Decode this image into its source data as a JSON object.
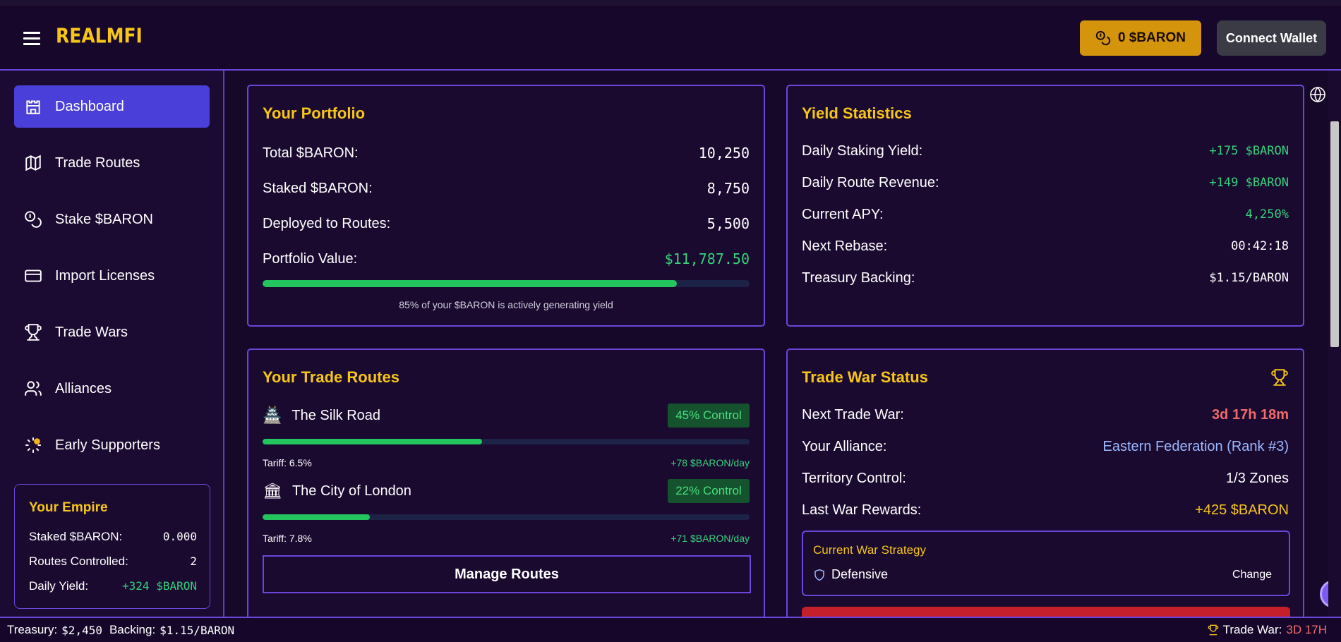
{
  "header": {
    "logo": "REALMFI",
    "baron_balance": "0 $BARON",
    "connect_wallet": "Connect Wallet"
  },
  "sidebar": {
    "items": [
      {
        "label": "Dashboard",
        "icon": "castle-icon",
        "active": true
      },
      {
        "label": "Trade Routes",
        "icon": "map-icon"
      },
      {
        "label": "Stake $BARON",
        "icon": "coins-icon"
      },
      {
        "label": "Import Licenses",
        "icon": "credit-card-icon"
      },
      {
        "label": "Trade Wars",
        "icon": "trophy-icon"
      },
      {
        "label": "Alliances",
        "icon": "users-icon"
      },
      {
        "label": "Early Supporters",
        "icon": "sparkle-icon"
      }
    ],
    "empire": {
      "title": "Your Empire",
      "rows": [
        {
          "label": "Staked $BARON:",
          "value": "0.000"
        },
        {
          "label": "Routes Controlled:",
          "value": "2"
        },
        {
          "label": "Daily Yield:",
          "value": "+324 $BARON"
        }
      ]
    }
  },
  "portfolio": {
    "title": "Your Portfolio",
    "rows": [
      {
        "label": "Total $BARON:",
        "value": "10,250"
      },
      {
        "label": "Staked $BARON:",
        "value": "8,750"
      },
      {
        "label": "Deployed to Routes:",
        "value": "5,500"
      },
      {
        "label": "Portfolio Value:",
        "value": "$11,787.50"
      }
    ],
    "progress": 0.85,
    "caption": "85% of your $BARON is actively generating yield"
  },
  "yield": {
    "title": "Yield Statistics",
    "rows": [
      {
        "label": "Daily Staking Yield:",
        "value": "+175 $BARON"
      },
      {
        "label": "Daily Route Revenue:",
        "value": "+149 $BARON"
      },
      {
        "label": "Current APY:",
        "value": "4,250%"
      },
      {
        "label": "Next Rebase:",
        "value": "00:42:18"
      },
      {
        "label": "Treasury Backing:",
        "value": "$1.15/BARON"
      }
    ]
  },
  "routes": {
    "title": "Your Trade Routes",
    "items": [
      {
        "name": "The Silk Road",
        "emoji": "🏯",
        "control": "45% Control",
        "progress": 0.45,
        "tariff": "Tariff: 6.5%",
        "yield": "+78 $BARON/day"
      },
      {
        "name": "The City of London",
        "emoji": "🏛",
        "control": "22% Control",
        "progress": 0.22,
        "tariff": "Tariff: 7.8%",
        "yield": "+71 $BARON/day"
      }
    ],
    "manage": "Manage Routes"
  },
  "war": {
    "title": "Trade War Status",
    "rows": [
      {
        "label": "Next Trade War:",
        "value": "3d 17h 18m"
      },
      {
        "label": "Your Alliance:",
        "value": "Eastern Federation (Rank #3)"
      },
      {
        "label": "Territory Control:",
        "value": "1/3 Zones"
      },
      {
        "label": "Last War Rewards:",
        "value": "+425 $BARON"
      }
    ],
    "strategy_title": "Current War Strategy",
    "strategy_value": "Defensive",
    "change": "Change"
  },
  "footer": {
    "treasury_label": "Treasury:",
    "treasury_value": "$2,450",
    "backing_label": "Backing:",
    "backing_value": "$1.15/BARON",
    "war_label": "Trade War:",
    "war_value": "3D 17H"
  },
  "colors": {
    "accent": "#6b46d9",
    "gold": "#f5c518",
    "green": "#34d27a",
    "active_nav": "#4a3fd8"
  }
}
